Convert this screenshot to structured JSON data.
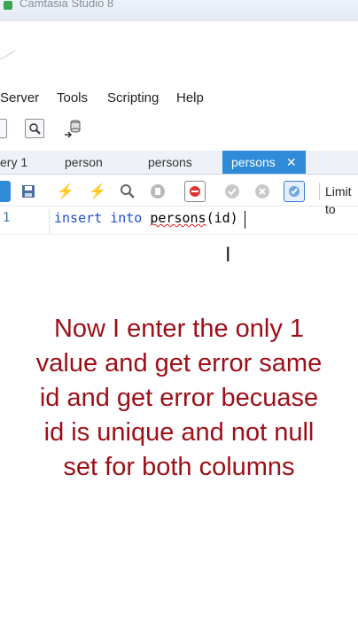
{
  "window": {
    "title": "Camtasia Studio 8"
  },
  "menu": {
    "items": [
      "Server",
      "Tools",
      "Scripting",
      "Help"
    ]
  },
  "tabs": {
    "items": [
      "ery 1",
      "person",
      "persons"
    ],
    "active_label": "persons",
    "close_glyph": "✕"
  },
  "toolbar": {
    "limit_label": "Limit to"
  },
  "editor": {
    "line_number": "1",
    "keyword1": "insert",
    "keyword2": "into",
    "table_name": "persons",
    "rest": "(id)"
  },
  "caption": {
    "text": "Now I enter the only 1 value and get error same id and get error becuase id is unique and not null set for both columns"
  },
  "colors": {
    "caption": "#9c0f17",
    "active_tab": "#2f8bd8",
    "keyword": "#1f4fc7"
  }
}
